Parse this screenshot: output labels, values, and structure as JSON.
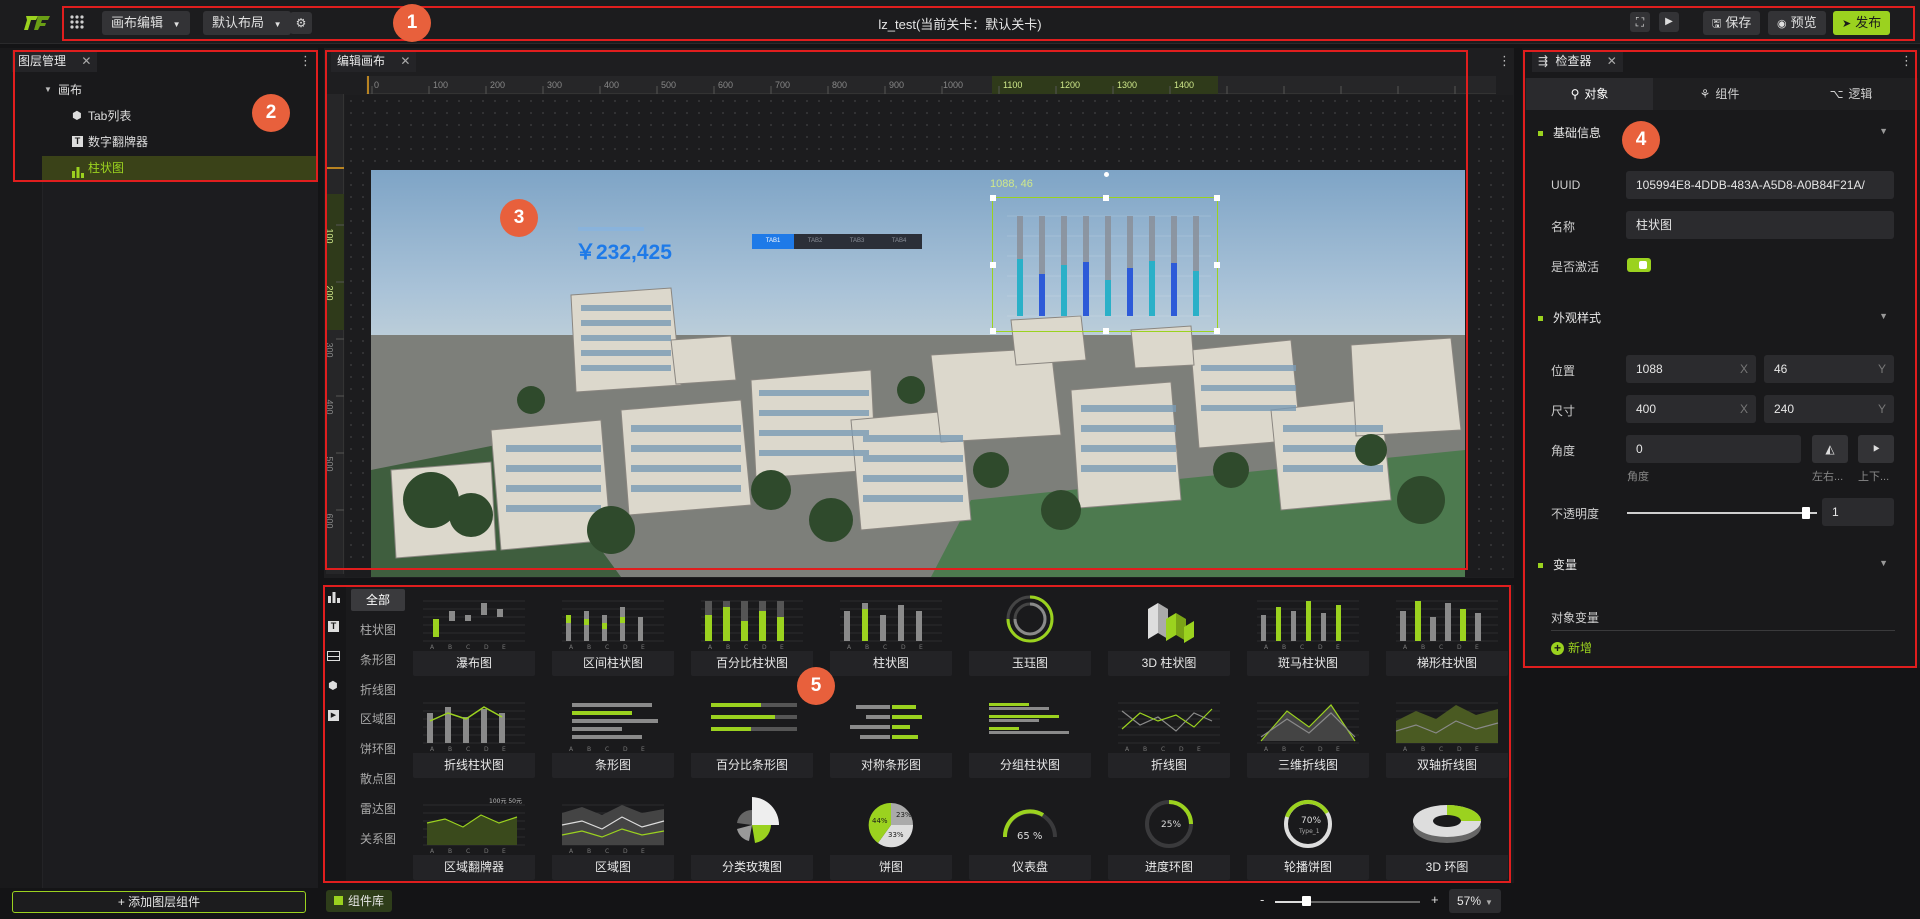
{
  "topbar": {
    "canvas_edit": "画布编辑",
    "default_layout": "默认布局",
    "title": "lz_test(当前关卡：默认关卡)",
    "save": "保存",
    "preview": "预览",
    "publish": "发布"
  },
  "layers": {
    "tab_label": "图层管理",
    "items": [
      "画布",
      "Tab列表",
      "数字翻牌器",
      "柱状图"
    ],
    "add_button": "+ 添加图层组件"
  },
  "canvas": {
    "tab_label": "编辑画布",
    "ruler_labels": [
      "0",
      "100",
      "200",
      "300",
      "400",
      "500",
      "600",
      "700",
      "800",
      "900",
      "1000",
      "1100",
      "1200",
      "1300",
      "1400"
    ],
    "vruler_labels": [
      "100",
      "200",
      "300",
      "400",
      "500",
      "600"
    ],
    "amount": "￥232,425",
    "tabs": [
      "TAB1",
      "TAB2",
      "TAB3",
      "TAB4"
    ],
    "coord_label": "1088, 46",
    "bar_values": [
      0.95,
      0.7,
      0.85,
      0.9,
      0.6,
      0.8,
      0.92,
      0.88,
      0.75
    ]
  },
  "inspector": {
    "tab_label": "检查器",
    "subtabs": [
      "对象",
      "组件",
      "逻辑"
    ],
    "basic_info": "基础信息",
    "uuid_label": "UUID",
    "uuid_value": "105994E8-4DDB-483A-A5D8-A0B84F21A/",
    "name_label": "名称",
    "name_value": "柱状图",
    "active_label": "是否激活",
    "appearance": "外观样式",
    "position_label": "位置",
    "pos_x": "1088",
    "pos_y": "46",
    "size_label": "尺寸",
    "size_x": "400",
    "size_y": "240",
    "x_axis": "X",
    "y_axis": "Y",
    "angle_label": "角度",
    "angle_value": "0",
    "angle_sub": "角度",
    "flip_lr": "左右...",
    "flip_ud": "上下...",
    "opacity_label": "不透明度",
    "opacity_value": "1",
    "opacity_level": 0.96,
    "variables": "变量",
    "object_var": "对象变量",
    "add_new": "新增"
  },
  "library": {
    "all_button": "全部",
    "categories": [
      "柱状图",
      "条形图",
      "折线图",
      "区域图",
      "饼环图",
      "散点图",
      "雷达图",
      "关系图"
    ],
    "cards": [
      "瀑布图",
      "区间柱状图",
      "百分比柱状图",
      "柱状图",
      "玉珏图",
      "3D 柱状图",
      "斑马柱状图",
      "梯形柱状图",
      "折线柱状图",
      "条形图",
      "百分比条形图",
      "对称条形图",
      "分组柱状图",
      "折线图",
      "三维折线图",
      "双轴折线图",
      "区域翻牌器",
      "区域图",
      "分类玫瑰图",
      "饼图",
      "仪表盘",
      "进度环图",
      "轮播饼图",
      "3D 环图"
    ],
    "pie_labels": [
      "44%",
      "23%",
      "33%"
    ],
    "gauge_value": "65 %",
    "progress_value": "25%",
    "rotate_value": "70%",
    "rotate_sub": "Type_1",
    "flip_header": "100元 50元"
  },
  "bottombar": {
    "library_button": "组件库",
    "zoom_minus": "-",
    "zoom_plus": "+",
    "zoom_value": "57%",
    "zoom_level": 0.2
  },
  "annotations": [
    "1",
    "2",
    "3",
    "4",
    "5"
  ],
  "colors": {
    "accent": "#9bd21f",
    "annotation": "#e01e1e",
    "badge": "#e8603c",
    "blue": "#1e7ae8"
  }
}
